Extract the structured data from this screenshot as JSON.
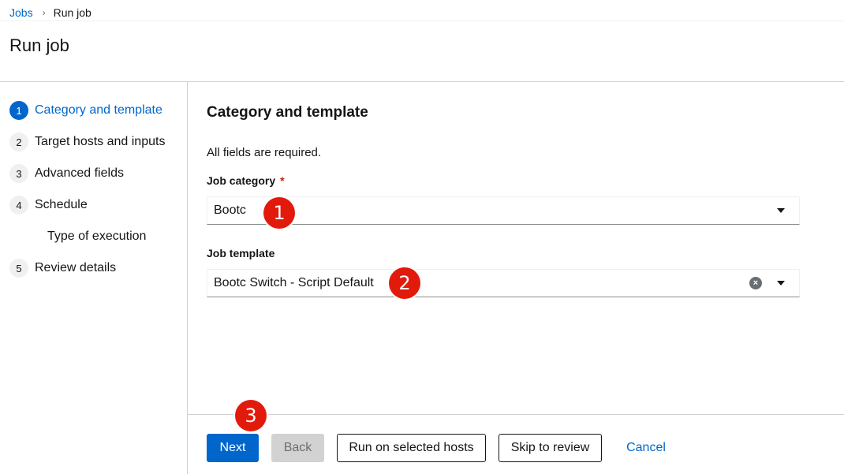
{
  "breadcrumb": {
    "parent": "Jobs",
    "current": "Run job"
  },
  "page_title": "Run job",
  "wizard_nav": [
    {
      "num": "1",
      "label": "Category and template",
      "current": true
    },
    {
      "num": "2",
      "label": "Target hosts and inputs"
    },
    {
      "num": "3",
      "label": "Advanced fields"
    },
    {
      "num": "4",
      "label": "Schedule"
    },
    {
      "sub": true,
      "label": "Type of execution"
    },
    {
      "num": "5",
      "label": "Review details"
    }
  ],
  "content": {
    "title": "Category and template",
    "helper": "All fields are required.",
    "job_category": {
      "label": "Job category",
      "required_mark": "*",
      "value": "Bootc"
    },
    "job_template": {
      "label": "Job template",
      "value": "Bootc Switch - Script Default"
    }
  },
  "footer": {
    "next": "Next",
    "back": "Back",
    "run_selected": "Run on selected hosts",
    "skip": "Skip to review",
    "cancel": "Cancel"
  },
  "callouts": [
    "1",
    "2",
    "3"
  ],
  "icons": {
    "separator": "chevron-right-icon",
    "clear": "times-circle-icon",
    "caret": "caret-down-icon"
  },
  "colors": {
    "primary": "#0066cc",
    "callout": "#e21a0c",
    "required": "#c9190b"
  }
}
